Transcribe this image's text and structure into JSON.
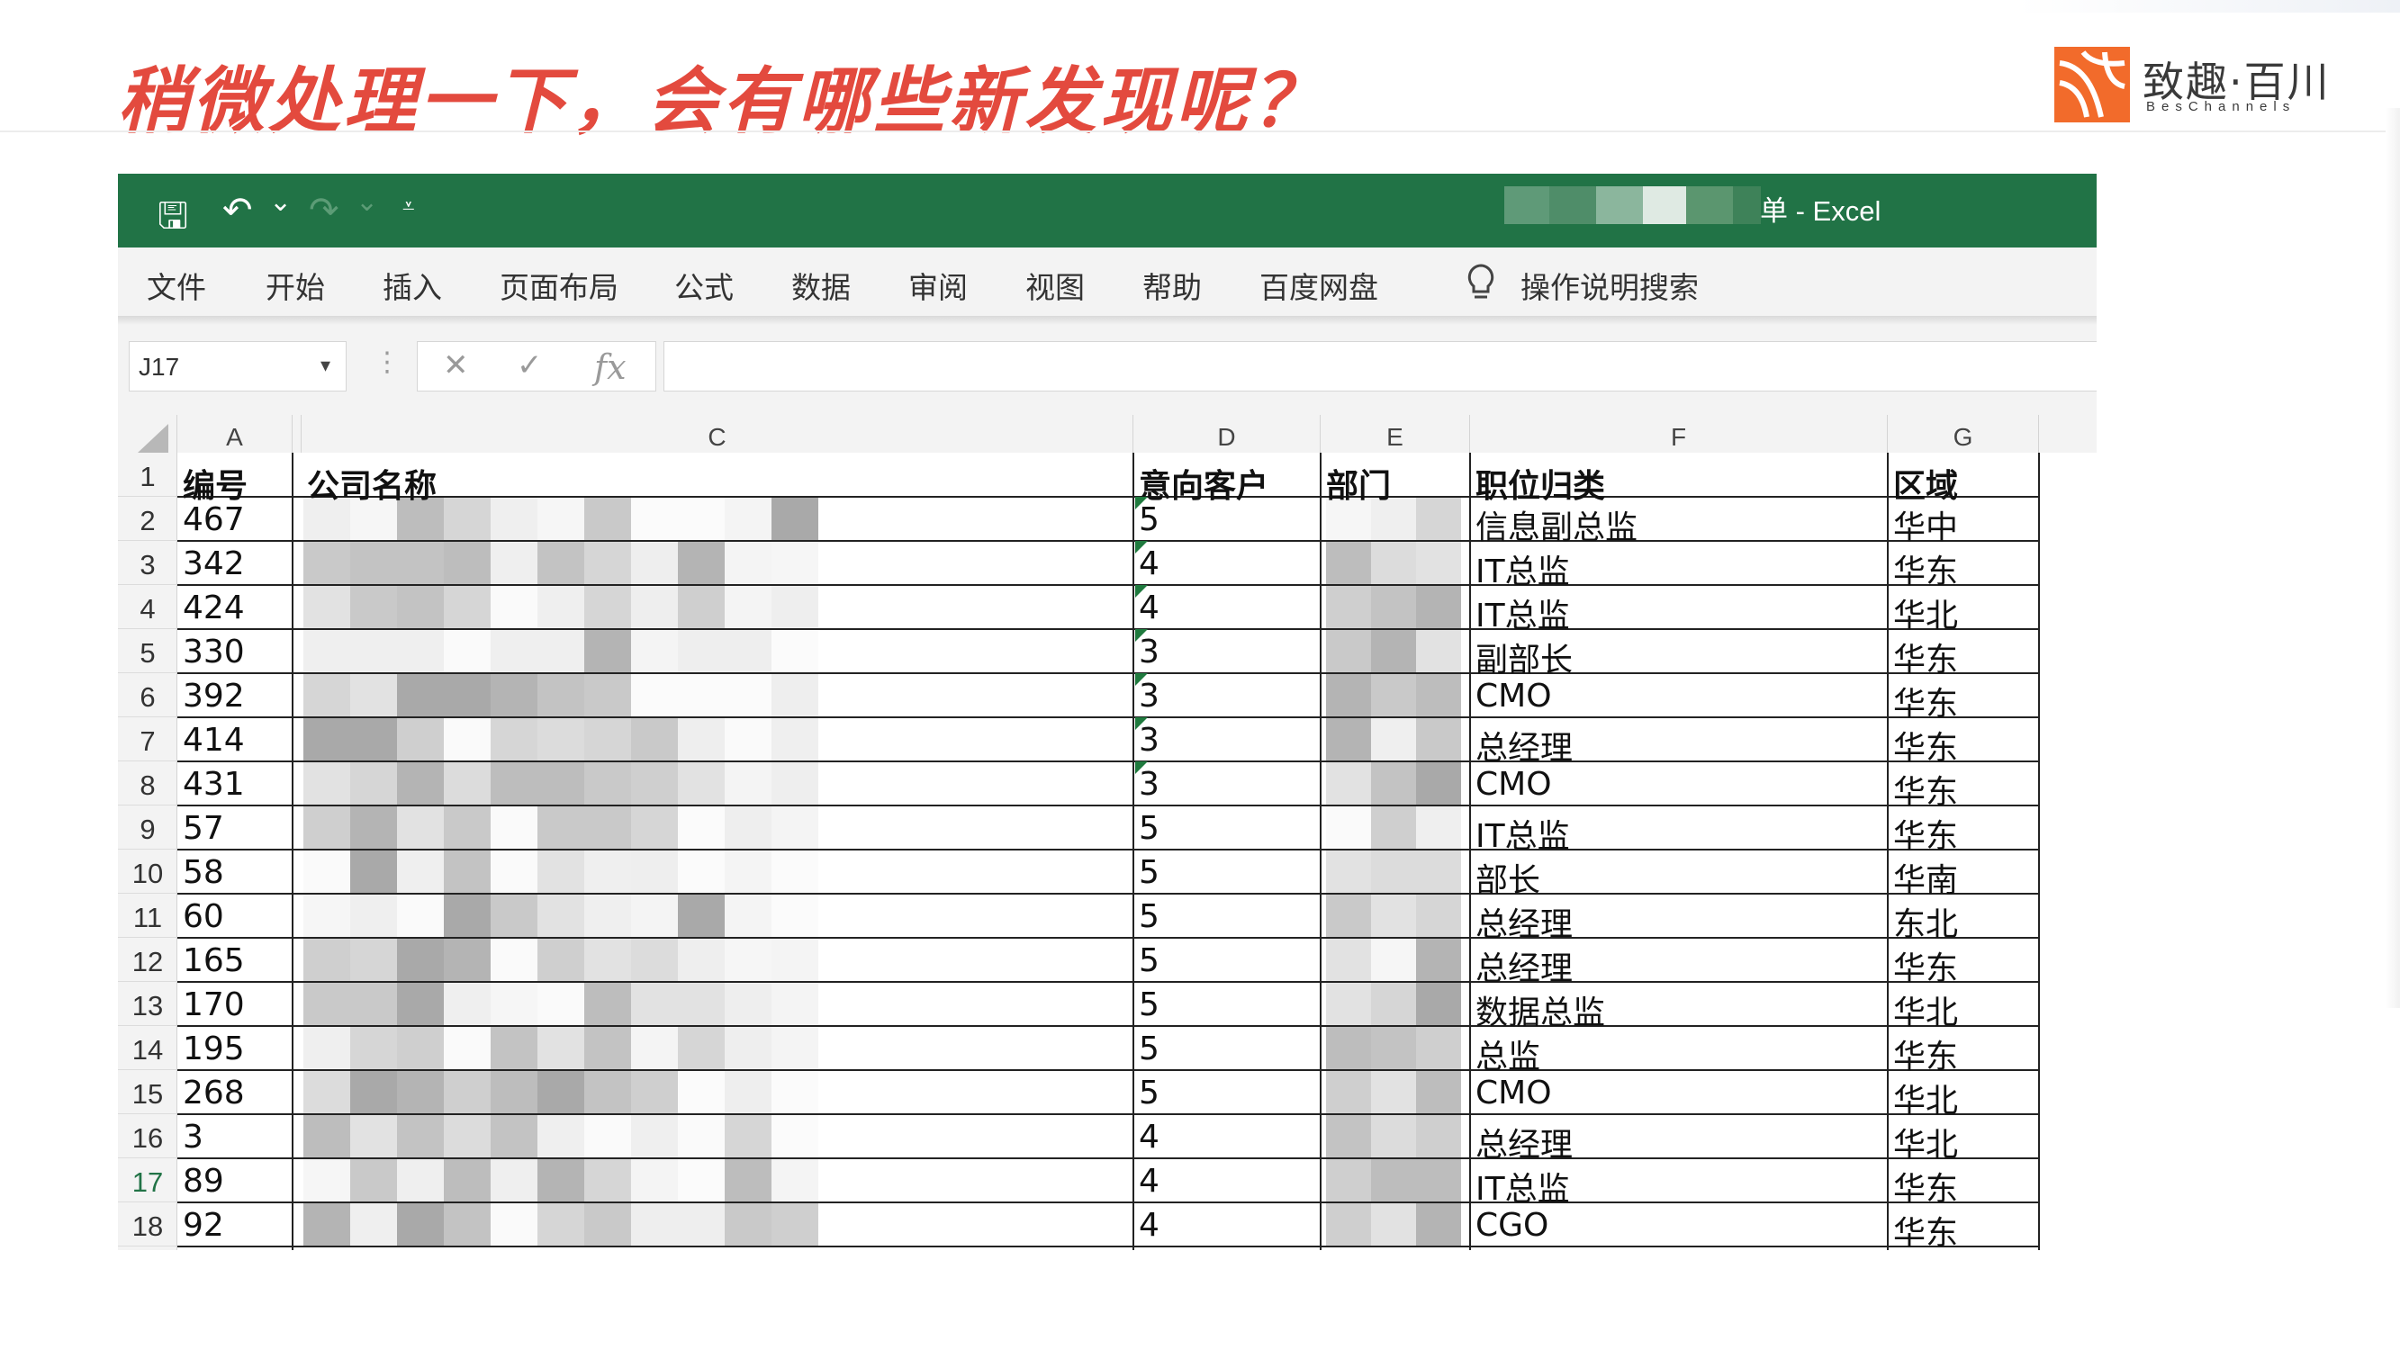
{
  "slide": {
    "title": "稍微处理一下，会有哪些新发现呢？",
    "logo_cn": "致趣·百川",
    "logo_en": "BesChannels",
    "title_color": "#e34a3e",
    "logo_color": "#f26b2b"
  },
  "window": {
    "title_suffix": "单 - Excel",
    "accent": "#217346",
    "save_icon": "save-icon",
    "undo_icon": "undo-icon",
    "redo_icon": "redo-icon",
    "qa_glyph_save": "🖫",
    "qa_glyph_undo": "↶",
    "qa_glyph_drop": "⌄",
    "qa_glyph_redo": "↷",
    "qa_glyph_customize": "⩡"
  },
  "ribbon": {
    "tabs": [
      "文件",
      "开始",
      "插入",
      "页面布局",
      "公式",
      "数据",
      "审阅",
      "视图",
      "帮助",
      "百度网盘"
    ],
    "tell_me": "操作说明搜索",
    "tell_me_icon": "lightbulb-icon"
  },
  "formula_bar": {
    "name_box": "J17",
    "cancel": "✕",
    "enter": "✓",
    "fx": "fx",
    "dots": "⋮",
    "dropdown": "▾"
  },
  "sheet": {
    "columns": [
      "A",
      "C",
      "D",
      "E",
      "F",
      "G"
    ],
    "header_row": {
      "id": "编号",
      "company": "公司名称",
      "intent": "意向客户",
      "dept": "部门",
      "title": "职位归类",
      "region": "区域"
    },
    "rows": [
      {
        "n": "2",
        "id": "467",
        "intent": "5",
        "title": "信息副总监",
        "region": "华中"
      },
      {
        "n": "3",
        "id": "342",
        "intent": "4",
        "title": "IT总监",
        "region": "华东"
      },
      {
        "n": "4",
        "id": "424",
        "intent": "4",
        "title": "IT总监",
        "region": "华北"
      },
      {
        "n": "5",
        "id": "330",
        "intent": "3",
        "title": "副部长",
        "region": "华东"
      },
      {
        "n": "6",
        "id": "392",
        "intent": "3",
        "title": "CMO",
        "region": "华东"
      },
      {
        "n": "7",
        "id": "414",
        "intent": "3",
        "title": "总经理",
        "region": "华东"
      },
      {
        "n": "8",
        "id": "431",
        "intent": "3",
        "title": "CMO",
        "region": "华东"
      },
      {
        "n": "9",
        "id": "57",
        "intent": "5",
        "title": "IT总监",
        "region": "华东"
      },
      {
        "n": "10",
        "id": "58",
        "intent": "5",
        "title": "部长",
        "region": "华南"
      },
      {
        "n": "11",
        "id": "60",
        "intent": "5",
        "title": "总经理",
        "region": "东北"
      },
      {
        "n": "12",
        "id": "165",
        "intent": "5",
        "title": "总经理",
        "region": "华东"
      },
      {
        "n": "13",
        "id": "170",
        "intent": "5",
        "title": "数据总监",
        "region": "华北"
      },
      {
        "n": "14",
        "id": "195",
        "intent": "5",
        "title": "总监",
        "region": "华东"
      },
      {
        "n": "15",
        "id": "268",
        "intent": "5",
        "title": "CMO",
        "region": "华北"
      },
      {
        "n": "16",
        "id": "3",
        "intent": "4",
        "title": "总经理",
        "region": "华北"
      },
      {
        "n": "17",
        "id": "89",
        "intent": "4",
        "title": "IT总监",
        "region": "华东"
      },
      {
        "n": "18",
        "id": "92",
        "intent": "4",
        "title": "CGO",
        "region": "华东"
      }
    ]
  }
}
